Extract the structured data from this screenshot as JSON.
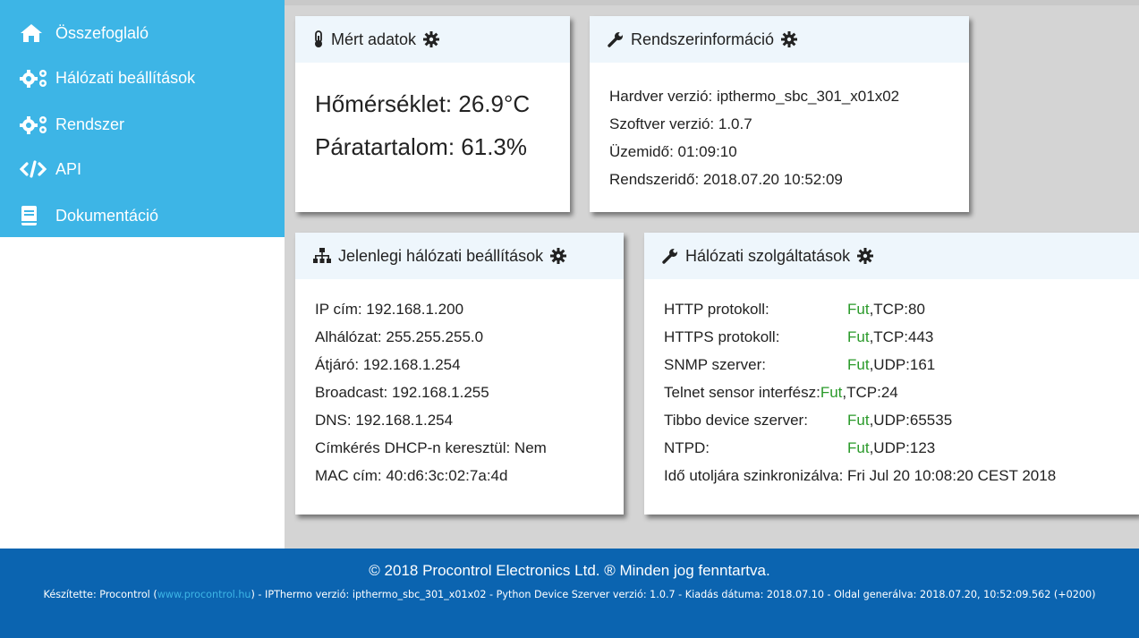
{
  "sidebar": {
    "items": [
      {
        "label": "Összefoglaló",
        "icon": "home-icon"
      },
      {
        "label": "Hálózati beállítások",
        "icon": "cogs-icon"
      },
      {
        "label": "Rendszer",
        "icon": "cogs-icon"
      },
      {
        "label": "API",
        "icon": "code-icon"
      },
      {
        "label": "Dokumentáció",
        "icon": "book-icon"
      }
    ]
  },
  "measured": {
    "title": "Mért adatok",
    "temperature": "Hőmérséklet: 26.9°C",
    "humidity": "Páratartalom: 61.3%"
  },
  "sysinfo": {
    "title": "Rendszerinformáció",
    "lines": [
      "Hardver verzió: ipthermo_sbc_301_x01x02",
      "Szoftver verzió: 1.0.7",
      "Üzemidő: 01:09:10",
      "Rendszeridő: 2018.07.20 10:52:09"
    ]
  },
  "network": {
    "title": "Jelenlegi hálózati beállítások",
    "lines": [
      "IP cím: 192.168.1.200",
      "Alhálózat: 255.255.255.0",
      "Átjáró: 192.168.1.254",
      "Broadcast: 192.168.1.255",
      "DNS: 192.168.1.254",
      "Címkérés DHCP-n keresztül: Nem",
      "MAC cím: 40:d6:3c:02:7a:4d"
    ]
  },
  "services": {
    "title": "Hálózati szolgáltatások",
    "rows": [
      {
        "name": "HTTP protokoll:",
        "status": "Fut",
        "port": ",TCP:80"
      },
      {
        "name": "HTTPS protokoll:",
        "status": "Fut",
        "port": ",TCP:443"
      },
      {
        "name": "SNMP szerver:",
        "status": "Fut",
        "port": ",UDP:161"
      },
      {
        "name": "Telnet sensor interfész:",
        "status": "Fut",
        "port": ",TCP:24"
      },
      {
        "name": "Tibbo device szerver:",
        "status": "Fut",
        "port": ",UDP:65535"
      },
      {
        "name": "NTPD:",
        "status": "Fut",
        "port": ",UDP:123"
      }
    ],
    "sync": "Idő utoljára szinkronizálva: Fri Jul 20 10:08:20 CEST 2018"
  },
  "footer": {
    "copyright": "© 2018 Procontrol Electronics Ltd. ® Minden jog fenntartva.",
    "made_by_prefix": "Készítette: Procontrol (",
    "link": "www.procontrol.hu",
    "made_by_suffix": ") - IPThermo verzió: ipthermo_sbc_301_x01x02 - Python Device Szerver verzió: 1.0.7 - Kiadás dátuma: 2018.07.10 - Oldal generálva: 2018.07.20, 10:52:09.562 (+0200)"
  },
  "colors": {
    "sidebar": "#3db5e6",
    "footer": "#0b64b0",
    "card_header": "#eef6fc",
    "ok": "#2a9a2a"
  }
}
